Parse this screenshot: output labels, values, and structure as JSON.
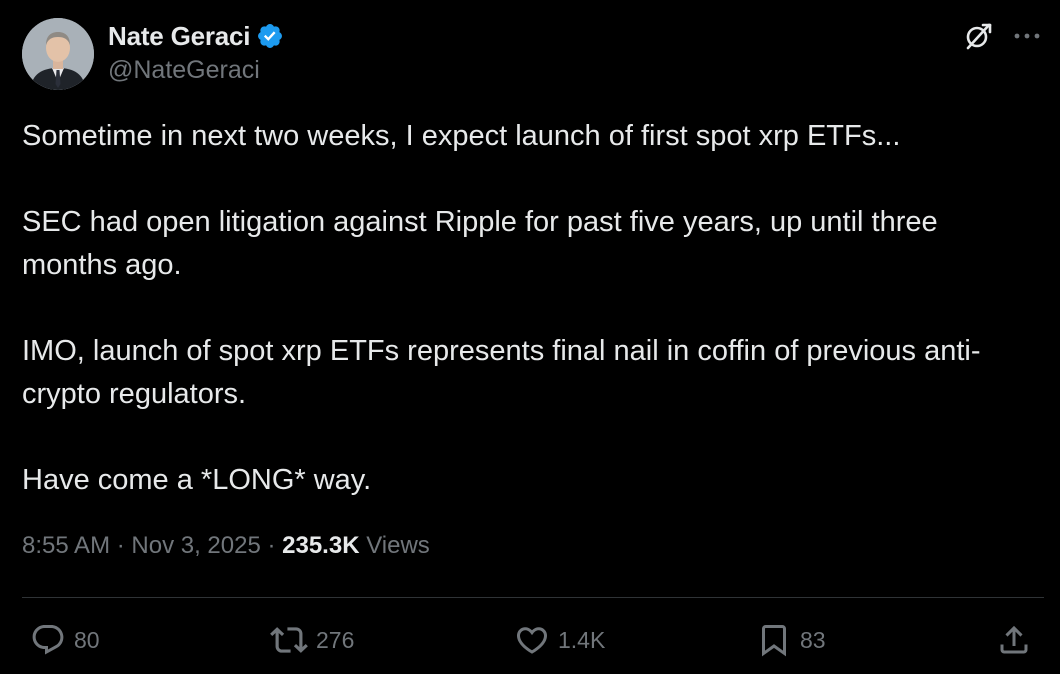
{
  "author": {
    "display_name": "Nate Geraci",
    "handle": "@NateGeraci",
    "verified": true
  },
  "tweet": {
    "paragraphs": [
      "Sometime in next two weeks, I expect launch of first spot xrp ETFs...",
      "SEC had open litigation against Ripple for past five years, up until three months ago.",
      "IMO, launch of spot xrp ETFs represents final nail in coffin of previous anti-crypto regulators.",
      "Have come a *LONG* way."
    ],
    "time": "8:55 AM",
    "separator": " · ",
    "date": "Nov 3, 2025",
    "views_count": "235.3K",
    "views_label": "Views"
  },
  "actions": {
    "replies": "80",
    "reposts": "276",
    "likes": "1.4K",
    "bookmarks": "83"
  },
  "icons": {
    "header": [
      "grok-icon",
      "more-icon"
    ],
    "actions": [
      "reply-icon",
      "repost-icon",
      "like-icon",
      "bookmark-icon",
      "share-icon"
    ]
  },
  "colors": {
    "background": "#000000",
    "text_primary": "#e7e9ea",
    "text_secondary": "#71767b",
    "verified_blue": "#1d9bf0",
    "divider": "#2f3336"
  }
}
